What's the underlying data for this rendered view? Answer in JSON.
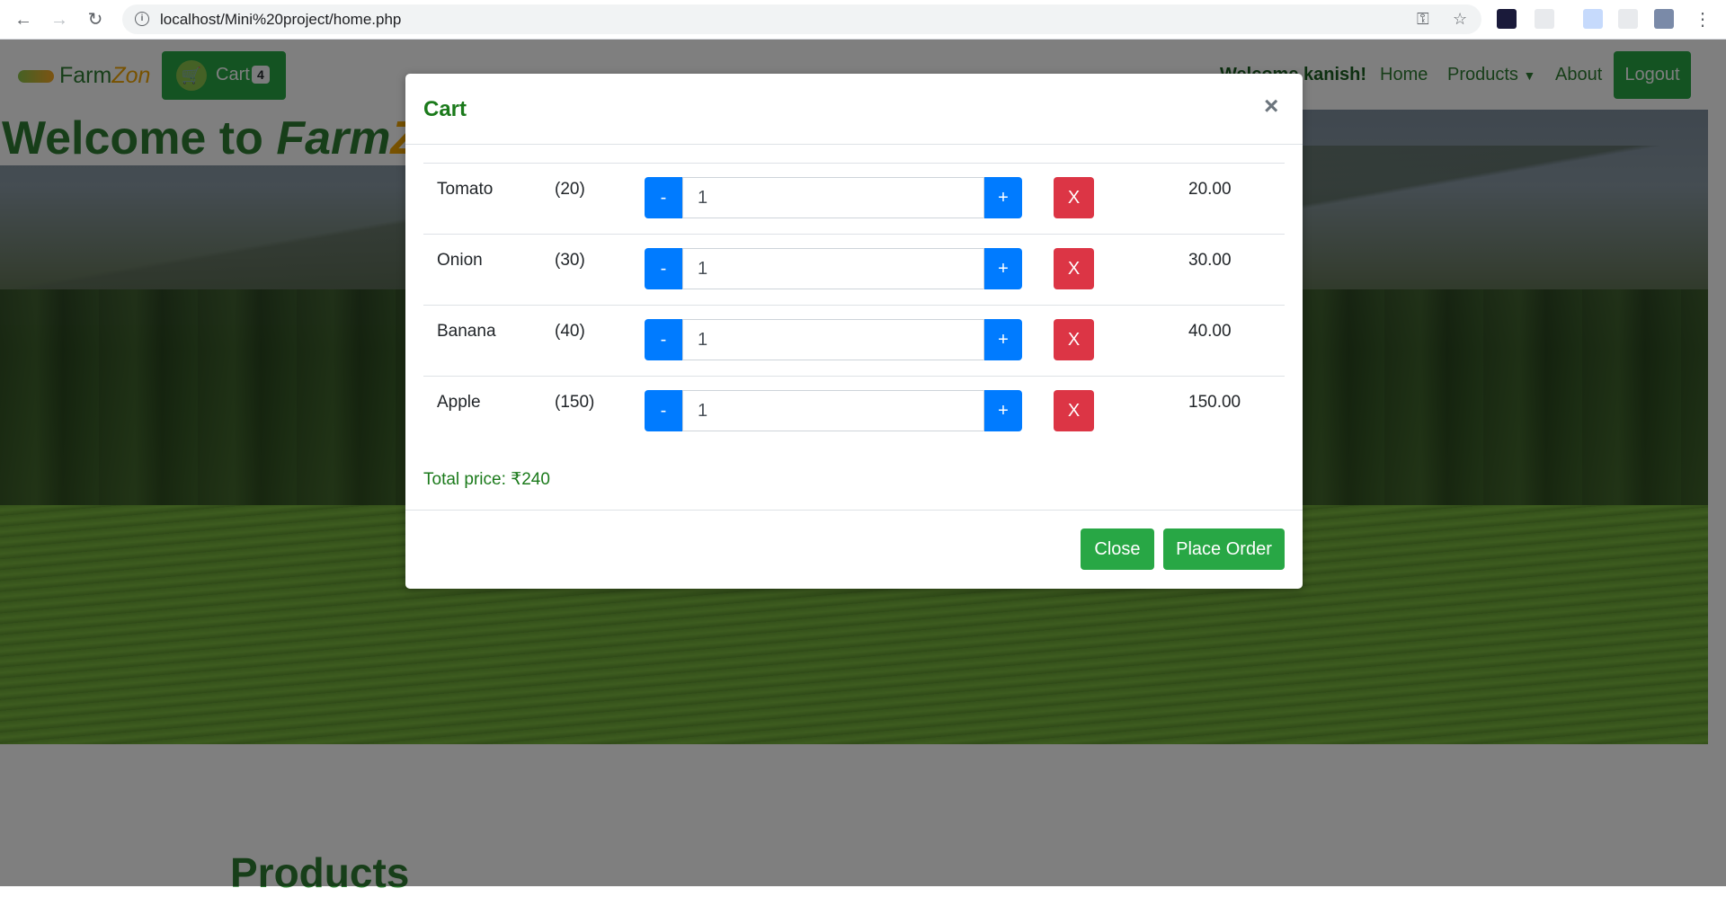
{
  "browser": {
    "url": "localhost/Mini%20project/home.php",
    "back_icon": "arrow-left-icon",
    "forward_icon": "arrow-right-icon",
    "reload_icon": "reload-icon"
  },
  "navbar": {
    "brand_prefix": "Farm",
    "brand_suffix": "Zon",
    "cart_label": "Cart",
    "cart_count": "4",
    "welcome": "Welcome kanish!",
    "links": [
      "Home",
      "Products",
      "About"
    ],
    "logout": "Logout"
  },
  "hero": {
    "title_prefix": "Welcome to ",
    "title_farm": "Farm",
    "title_zon": "Zon"
  },
  "products_heading": "Products",
  "modal": {
    "title": "Cart",
    "close_symbol": "×",
    "items": [
      {
        "name": "Tomato",
        "unit_price": "(20)",
        "minus": "-",
        "qty": "1",
        "plus": "+",
        "remove": "X",
        "total": "20.00"
      },
      {
        "name": "Onion",
        "unit_price": "(30)",
        "minus": "-",
        "qty": "1",
        "plus": "+",
        "remove": "X",
        "total": "30.00"
      },
      {
        "name": "Banana",
        "unit_price": "(40)",
        "minus": "-",
        "qty": "1",
        "plus": "+",
        "remove": "X",
        "total": "40.00"
      },
      {
        "name": "Apple",
        "unit_price": "(150)",
        "minus": "-",
        "qty": "1",
        "plus": "+",
        "remove": "X",
        "total": "150.00"
      }
    ],
    "total_price": "Total price: ₹240",
    "close_button": "Close",
    "place_order_button": "Place Order"
  },
  "colors": {
    "primary": "#007bff",
    "success": "#28a745",
    "danger": "#dc3545",
    "brand_green": "#2e7d32",
    "brand_orange": "#f0a500"
  }
}
